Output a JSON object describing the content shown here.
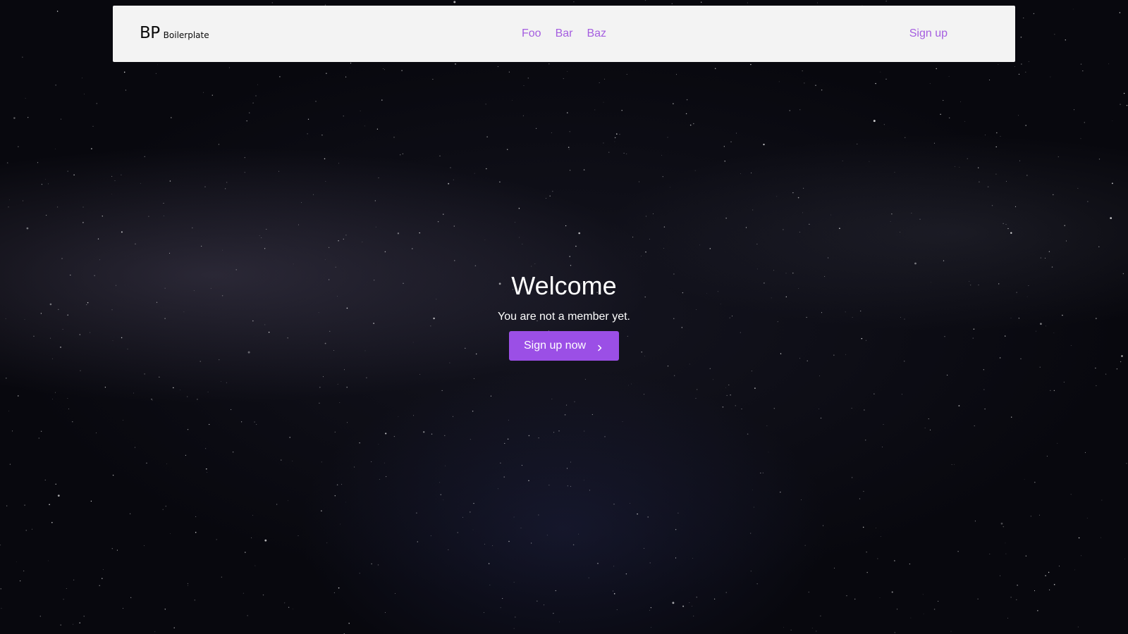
{
  "navbar": {
    "brand": {
      "mark": "BP",
      "name": "Boilerplate"
    },
    "links": [
      {
        "label": "Foo"
      },
      {
        "label": "Bar"
      },
      {
        "label": "Baz"
      }
    ],
    "end": {
      "signup_label": "Sign up"
    }
  },
  "hero": {
    "title": "Welcome",
    "subtitle": "You are not a member yet.",
    "cta": {
      "label": "Sign up now",
      "icon": "chevron-right-icon"
    }
  },
  "colors": {
    "accent": "#9b4fe6",
    "link": "#a55ee0",
    "navbar_bg": "#f3f3f3",
    "hero_text": "#ffffff"
  }
}
